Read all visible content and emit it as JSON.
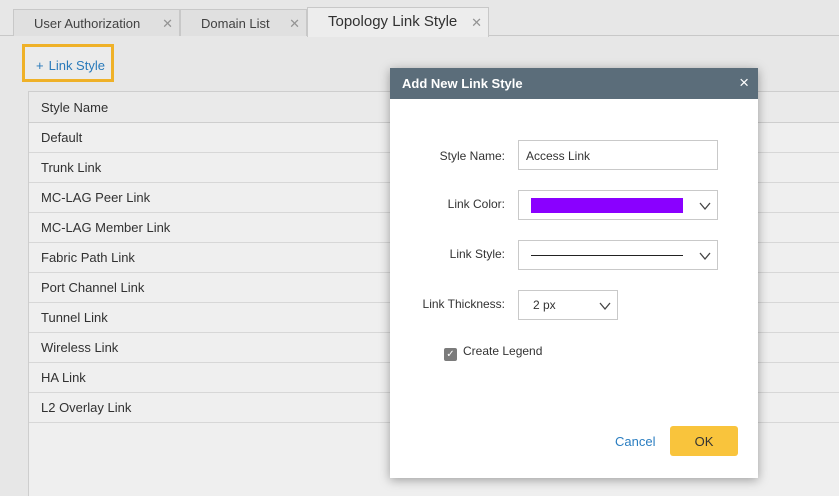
{
  "tabs": [
    {
      "label": "User Authorization"
    },
    {
      "label": "Domain List"
    },
    {
      "label": "Topology Link Style"
    }
  ],
  "toolbar": {
    "add_label": "Link Style",
    "add_symbol": "+"
  },
  "table": {
    "header": "Style Name",
    "rows": [
      "Default",
      "Trunk Link",
      "MC-LAG Peer Link",
      "MC-LAG Member Link",
      "Fabric Path Link",
      "Port Channel Link",
      "Tunnel Link",
      "Wireless Link",
      "HA Link",
      "L2 Overlay Link"
    ]
  },
  "modal": {
    "title": "Add New Link Style",
    "close_symbol": "×",
    "style_name_label": "Style Name:",
    "style_name_value": "Access Link",
    "link_color_label": "Link Color:",
    "link_color_value": "#8a00ff",
    "link_style_label": "Link Style:",
    "link_style_value": "solid",
    "link_thickness_label": "Link Thickness:",
    "link_thickness_value": "2 px",
    "create_legend_label": "Create Legend",
    "create_legend_checked": true,
    "cancel_label": "Cancel",
    "ok_label": "OK"
  },
  "colors": {
    "accent": "#2b7ec1",
    "highlight": "#f7b72a",
    "ok_button": "#f9c43c",
    "header": "#5b6d7a"
  }
}
